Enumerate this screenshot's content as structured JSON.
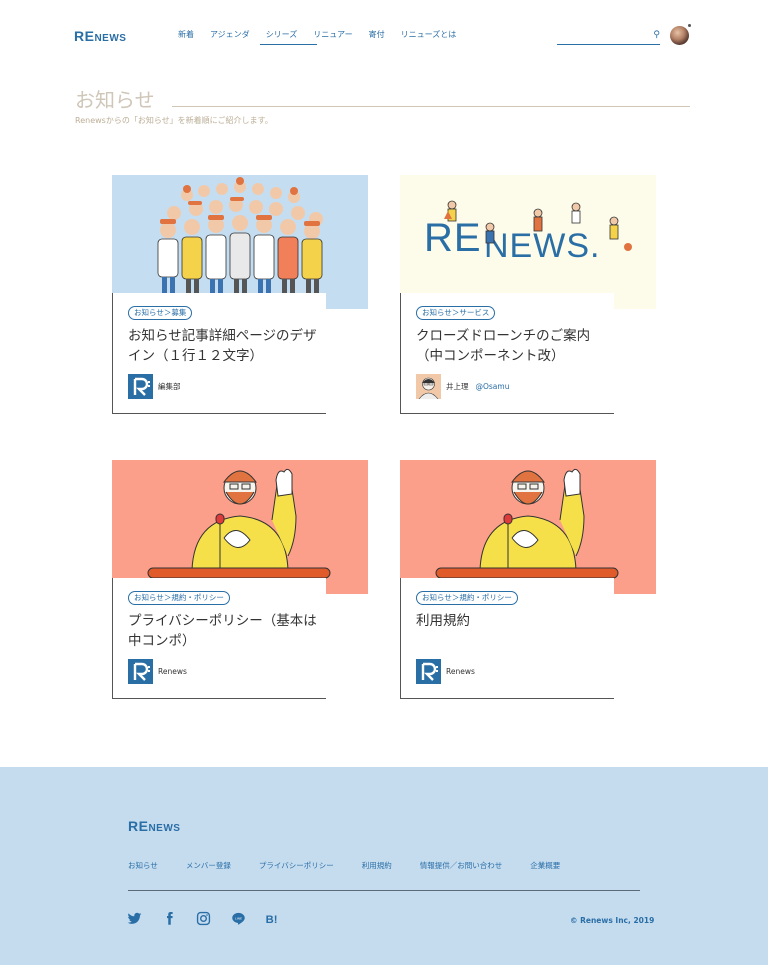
{
  "header": {
    "logo_big1": "RE",
    "logo_small": "NEWS",
    "nav": [
      "新着",
      "アジェンダ",
      "シリーズ",
      "リニュアー",
      "寄付",
      "リニューズとは"
    ],
    "search_placeholder": ""
  },
  "page": {
    "title": "お知らせ",
    "subtitle": "Renewsからの「お知らせ」を新着順にご紹介します。"
  },
  "cards": [
    {
      "tag": "お知らせ＞募集",
      "title": "お知らせ記事詳細ページのデザイン（１行１２文字）",
      "author": "編集部",
      "handle": "",
      "image": "crowd-illustration"
    },
    {
      "tag": "お知らせ＞サービス",
      "title": "クローズドローンチのご案内（中コンポーネント改）",
      "author": "井上理",
      "handle": "@Osamu",
      "image": "renews-logo-illustration"
    },
    {
      "tag": "お知らせ＞規約・ポリシー",
      "title": "プライバシーポリシー（基本は中コンポ）",
      "author": "Renews",
      "handle": "",
      "image": "oath-illustration"
    },
    {
      "tag": "お知らせ＞規約・ポリシー",
      "title": "利用規約",
      "author": "Renews",
      "handle": "",
      "image": "oath-illustration"
    }
  ],
  "footer": {
    "logo_big1": "RE",
    "logo_small": "NEWS",
    "links": [
      "お知らせ",
      "メンバー登録",
      "プライバシーポリシー",
      "利用規約",
      "情報提供／お問い合わせ",
      "企業概要"
    ],
    "social": [
      "twitter-icon",
      "facebook-icon",
      "instagram-icon",
      "line-icon",
      "hatena-bookmark-icon"
    ],
    "copyright": "© Renews Inc, 2019"
  },
  "colors": {
    "accent": "#2a6ea6",
    "footer_bg": "#c5dcef",
    "sky": "#c4ddf0",
    "cream": "#fdfbea",
    "salmon": "#fb9f8a"
  }
}
